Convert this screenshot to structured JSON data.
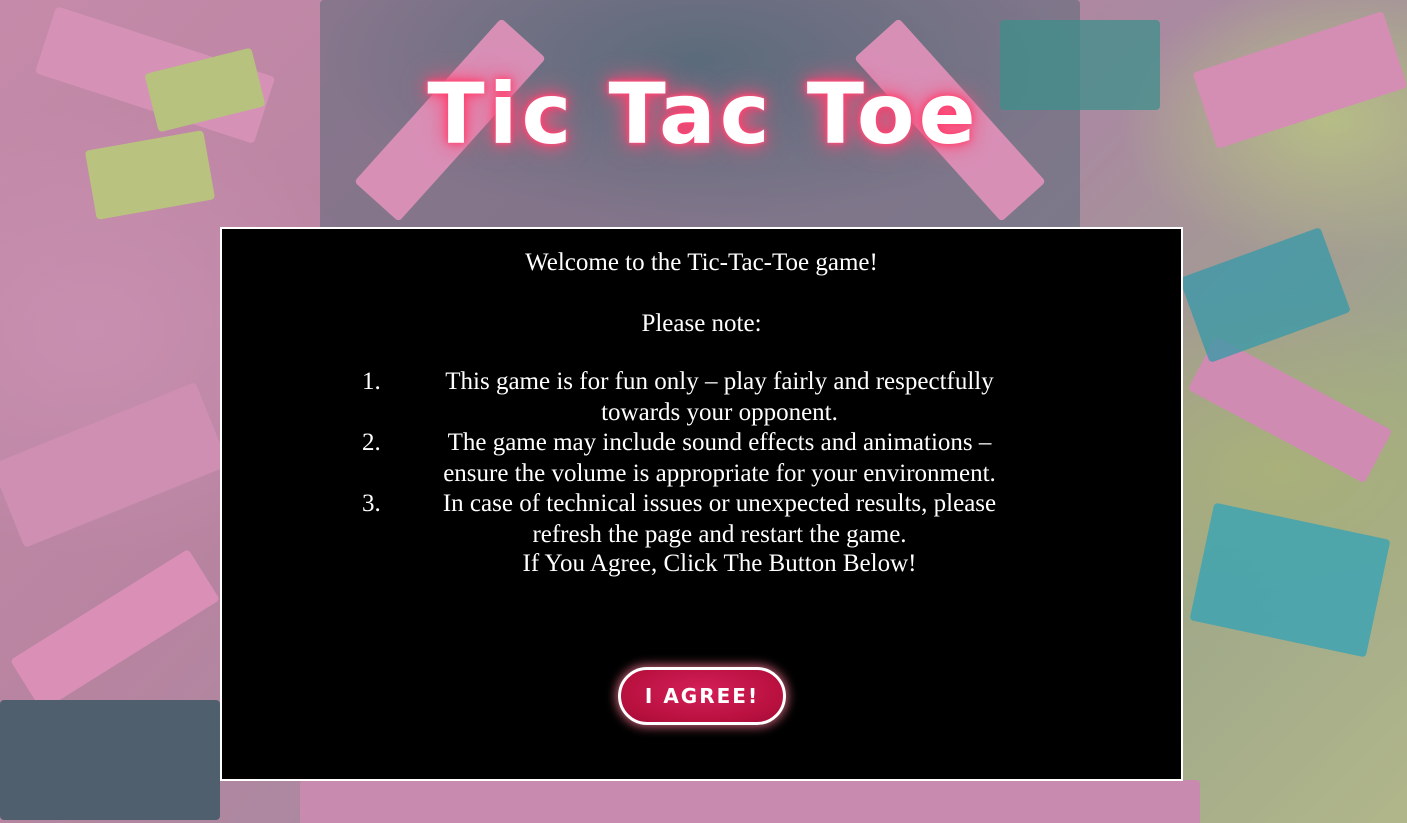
{
  "page": {
    "title": "Tic Tac Toe"
  },
  "notice": {
    "welcome": "Welcome to the Tic-Tac-Toe game!",
    "note_heading": "Please note:",
    "rules": [
      {
        "number": "1.",
        "text": "This game is for fun only – play fairly and respectfully towards your opponent."
      },
      {
        "number": "2.",
        "text": "The game may include sound effects and animations – ensure the volume is appropriate for your environment."
      },
      {
        "number": "3.",
        "text": "In case of technical issues or unexpected results, please refresh the page and restart the game."
      }
    ],
    "agree_prompt": "If You Agree, Click The Button Below!",
    "agree_button_label": "I AGREE!"
  },
  "colors": {
    "title_glow": "#ff3d6e",
    "panel_background": "#000000",
    "panel_border": "#ffffff",
    "button_background": "#c2144a",
    "button_border": "#ffffff"
  }
}
